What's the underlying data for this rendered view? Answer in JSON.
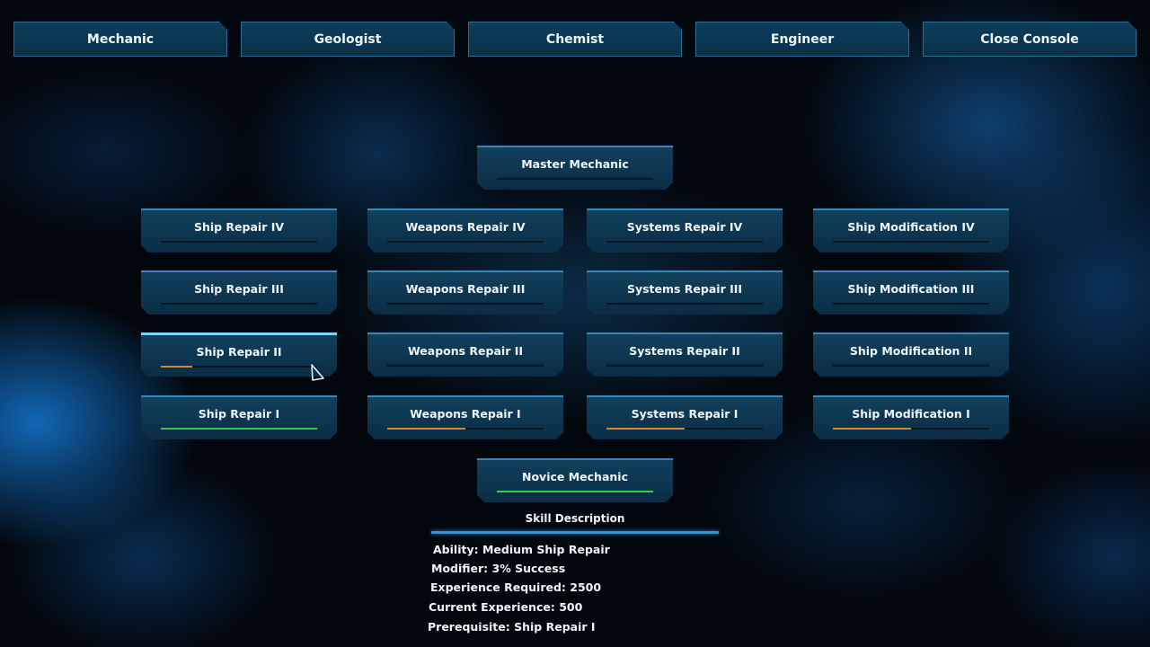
{
  "tabs": [
    {
      "label": "Mechanic"
    },
    {
      "label": "Geologist"
    },
    {
      "label": "Chemist"
    },
    {
      "label": "Engineer"
    },
    {
      "label": "Close Console"
    }
  ],
  "master": {
    "label": "Master Mechanic",
    "progress": 0,
    "color": "#2c3b46"
  },
  "novice": {
    "label": "Novice Mechanic",
    "progress": 1.0,
    "color": "#2fd34a"
  },
  "grid": [
    [
      {
        "label": "Ship Repair IV",
        "progress": 0,
        "color": "#2c3b46"
      },
      {
        "label": "Weapons Repair IV",
        "progress": 0,
        "color": "#2c3b46"
      },
      {
        "label": "Systems Repair IV",
        "progress": 0,
        "color": "#2c3b46"
      },
      {
        "label": "Ship Modification IV",
        "progress": 0,
        "color": "#2c3b46"
      }
    ],
    [
      {
        "label": "Ship Repair III",
        "progress": 0,
        "color": "#2c3b46"
      },
      {
        "label": "Weapons Repair III",
        "progress": 0,
        "color": "#2c3b46"
      },
      {
        "label": "Systems Repair III",
        "progress": 0,
        "color": "#2c3b46"
      },
      {
        "label": "Ship Modification III",
        "progress": 0,
        "color": "#2c3b46"
      }
    ],
    [
      {
        "label": "Ship Repair II",
        "progress": 0.2,
        "color": "#d9862a",
        "selected": true
      },
      {
        "label": "Weapons Repair II",
        "progress": 0,
        "color": "#2c3b46"
      },
      {
        "label": "Systems Repair II",
        "progress": 0,
        "color": "#2c3b46"
      },
      {
        "label": "Ship Modification II",
        "progress": 0,
        "color": "#2c3b46"
      }
    ],
    [
      {
        "label": "Ship Repair I",
        "progress": 1.0,
        "color": "#2fd34a"
      },
      {
        "label": "Weapons Repair I",
        "progress": 0.5,
        "color": "#d9862a"
      },
      {
        "label": "Systems Repair I",
        "progress": 0.5,
        "color": "#d9862a"
      },
      {
        "label": "Ship Modification I",
        "progress": 0.5,
        "color": "#d9862a"
      }
    ]
  ],
  "description": {
    "title": "Skill Description",
    "ability": "Ability: Medium Ship Repair",
    "modifier": "Modifier: 3% Success",
    "experience_required": "Experience Required: 2500",
    "current_experience": "Current Experience: 500",
    "prerequisite": "Prerequisite: Ship Repair I"
  }
}
